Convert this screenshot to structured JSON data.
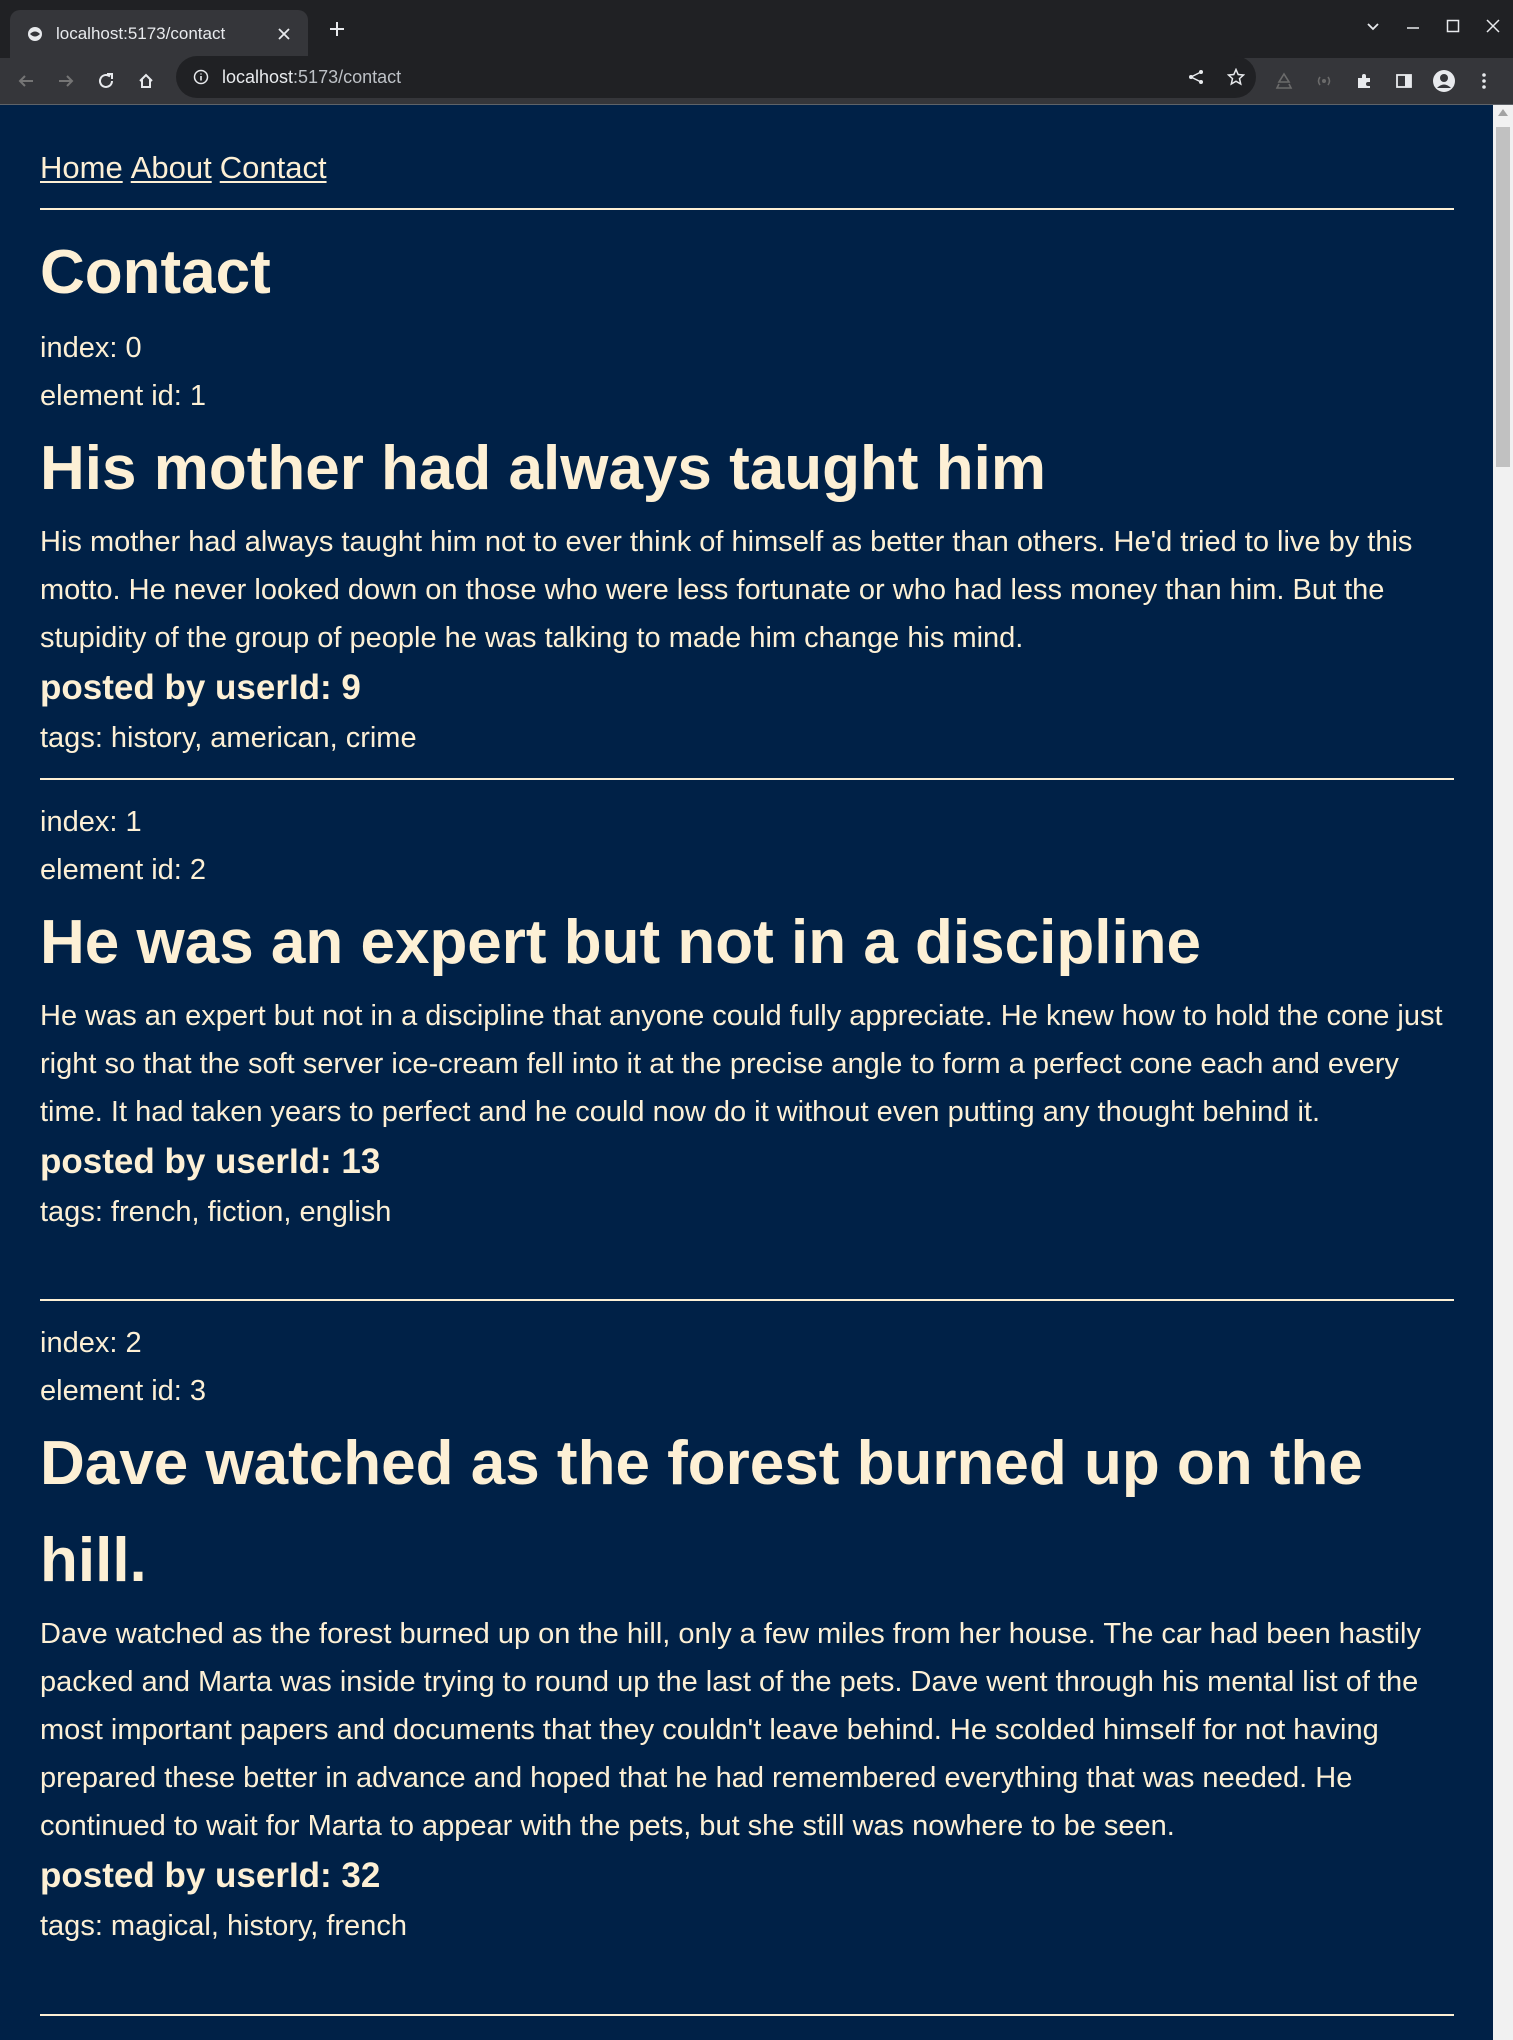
{
  "browser": {
    "tab_title": "localhost:5173/contact",
    "url_host": "localhost",
    "url_path": ":5173/contact"
  },
  "nav": {
    "home": "Home",
    "about": "About",
    "contact": "Contact"
  },
  "page": {
    "heading": "Contact"
  },
  "posts": [
    {
      "index_label": "index: 0",
      "id_label": "element id: 1",
      "title": "His mother had always taught him",
      "body": "His mother had always taught him not to ever think of himself as better than others. He'd tried to live by this motto. He never looked down on those who were less fortunate or who had less money than him. But the stupidity of the group of people he was talking to made him change his mind.",
      "posted_by": "posted by userId: 9",
      "tags": "tags: history, american, crime"
    },
    {
      "index_label": "index: 1",
      "id_label": "element id: 2",
      "title": "He was an expert but not in a discipline",
      "body": "He was an expert but not in a discipline that anyone could fully appreciate. He knew how to hold the cone just right so that the soft server ice-cream fell into it at the precise angle to form a perfect cone each and every time. It had taken years to perfect and he could now do it without even putting any thought behind it.",
      "posted_by": "posted by userId: 13",
      "tags": "tags: french, fiction, english"
    },
    {
      "index_label": "index: 2",
      "id_label": "element id: 3",
      "title": "Dave watched as the forest burned up on the hill.",
      "body": "Dave watched as the forest burned up on the hill, only a few miles from her house. The car had been hastily packed and Marta was inside trying to round up the last of the pets. Dave went through his mental list of the most important papers and documents that they couldn't leave behind. He scolded himself for not having prepared these better in advance and hoped that he had remembered everything that was needed. He continued to wait for Marta to appear with the pets, but she still was nowhere to be seen.",
      "posted_by": "posted by userId: 32",
      "tags": "tags: magical, history, french"
    }
  ]
}
